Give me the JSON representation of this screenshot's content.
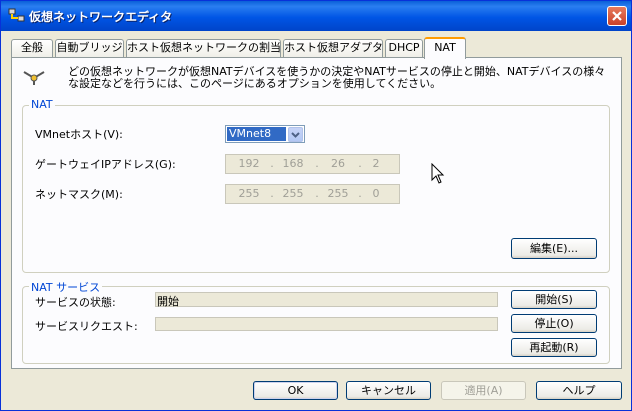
{
  "window": {
    "title": "仮想ネットワークエディタ"
  },
  "tabs": [
    {
      "label": "全般"
    },
    {
      "label": "自動ブリッジ"
    },
    {
      "label": "ホスト仮想ネットワークの割当て"
    },
    {
      "label": "ホスト仮想アダプタ"
    },
    {
      "label": "DHCP"
    },
    {
      "label": "NAT"
    }
  ],
  "active_tab": "NAT",
  "description": "どの仮想ネットワークが仮想NATデバイスを使うかの決定やNATサービスの停止と開始、NATデバイスの様々な設定などを行うには、このページにあるオプションを使用してください。",
  "nat": {
    "legend": "NAT",
    "vmnet_host_label": "VMnetホスト(V):",
    "vmnet_host_value": "VMnet8",
    "gateway_label": "ゲートウェイIPアドレス(G):",
    "gateway_octets": [
      "192",
      "168",
      "26",
      "2"
    ],
    "netmask_label": "ネットマスク(M):",
    "netmask_octets": [
      "255",
      "255",
      "255",
      "0"
    ],
    "edit_button": "編集(E)..."
  },
  "service": {
    "legend": "NAT サービス",
    "status_label": "サービスの状態:",
    "status_value": "開始",
    "request_label": "サービスリクエスト:",
    "request_value": "",
    "start_button": "開始(S)",
    "stop_button": "停止(O)",
    "restart_button": "再起動(R)"
  },
  "footer": {
    "ok": "OK",
    "cancel": "キャンセル",
    "apply": "適用(A)",
    "help": "ヘルプ"
  },
  "colors": {
    "titlebar": "#0055e5",
    "legend_text": "#0046d5",
    "active_tab_accent": "#ff9c00",
    "selection": "#316ac5"
  }
}
